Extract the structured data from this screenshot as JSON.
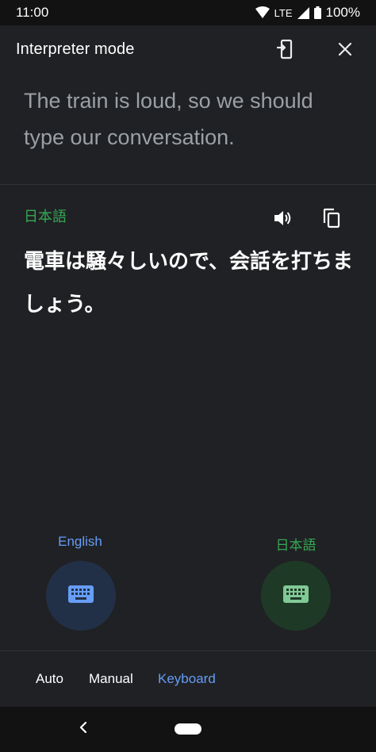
{
  "status_bar": {
    "time": "11:00",
    "network": "LTE",
    "battery": "100%",
    "icons": [
      "wifi-icon",
      "signal-icon",
      "battery-icon"
    ]
  },
  "header": {
    "title": "Interpreter mode",
    "icons": [
      "switch-screen-icon",
      "close-icon"
    ]
  },
  "source": {
    "text": "The train is loud, so we should type our conversation."
  },
  "target": {
    "language": "日本語",
    "text": "電車は騒々しいので、会話を打ちましょう。",
    "icons": [
      "speaker-icon",
      "copy-icon"
    ]
  },
  "speakers": {
    "left": {
      "label": "English",
      "icon": "keyboard-icon"
    },
    "right": {
      "label": "日本語",
      "icon": "keyboard-icon"
    }
  },
  "modes": {
    "items": [
      "Auto",
      "Manual",
      "Keyboard"
    ],
    "selected": "Keyboard"
  },
  "colors": {
    "background": "#202124",
    "english_accent": "#669df6",
    "japanese_accent": "#34a853",
    "english_button_bg": "#223047",
    "japanese_button_bg": "#1e3a27"
  },
  "nav": {
    "icons": [
      "back-icon",
      "home-pill-icon"
    ]
  }
}
